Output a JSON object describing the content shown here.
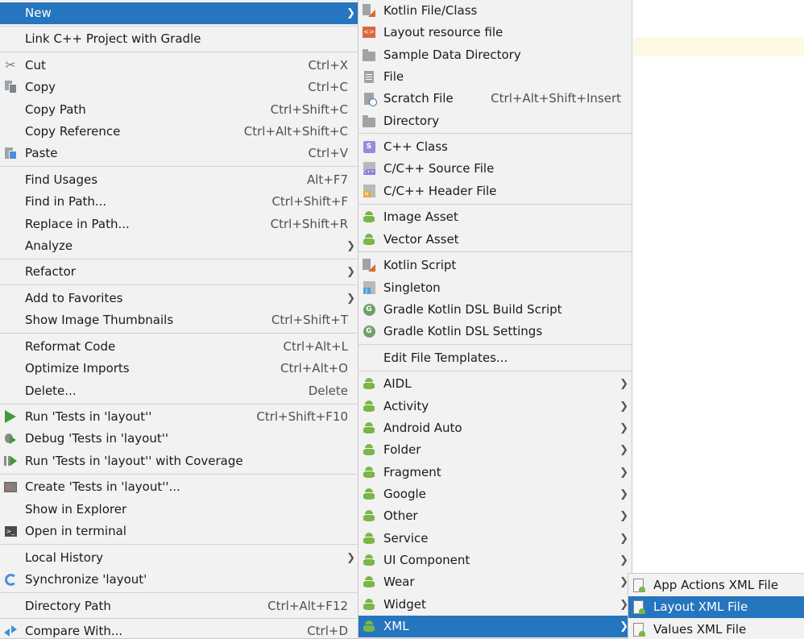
{
  "main_menu": [
    {
      "label": "New",
      "shortcut": "",
      "submenu": true,
      "selected": true,
      "icon": ""
    },
    {
      "label": "Link C++ Project with Gradle",
      "shortcut": "",
      "icon": ""
    },
    {
      "label": "Cut",
      "shortcut": "Ctrl+X",
      "icon": "scissors-icon"
    },
    {
      "label": "Copy",
      "shortcut": "Ctrl+C",
      "icon": "copy-icon"
    },
    {
      "label": "Copy Path",
      "shortcut": "Ctrl+Shift+C",
      "icon": ""
    },
    {
      "label": "Copy Reference",
      "shortcut": "Ctrl+Alt+Shift+C",
      "icon": ""
    },
    {
      "label": "Paste",
      "shortcut": "Ctrl+V",
      "icon": "paste-icon"
    },
    {
      "label": "Find Usages",
      "shortcut": "Alt+F7",
      "icon": ""
    },
    {
      "label": "Find in Path...",
      "shortcut": "Ctrl+Shift+F",
      "icon": ""
    },
    {
      "label": "Replace in Path...",
      "shortcut": "Ctrl+Shift+R",
      "icon": ""
    },
    {
      "label": "Analyze",
      "shortcut": "",
      "submenu": true,
      "icon": ""
    },
    {
      "label": "Refactor",
      "shortcut": "",
      "submenu": true,
      "icon": ""
    },
    {
      "label": "Add to Favorites",
      "shortcut": "",
      "submenu": true,
      "icon": ""
    },
    {
      "label": "Show Image Thumbnails",
      "shortcut": "Ctrl+Shift+T",
      "icon": ""
    },
    {
      "label": "Reformat Code",
      "shortcut": "Ctrl+Alt+L",
      "icon": ""
    },
    {
      "label": "Optimize Imports",
      "shortcut": "Ctrl+Alt+O",
      "icon": ""
    },
    {
      "label": "Delete...",
      "shortcut": "Delete",
      "icon": ""
    },
    {
      "label": "Run 'Tests in 'layout''",
      "shortcut": "Ctrl+Shift+F10",
      "icon": "run-icon"
    },
    {
      "label": "Debug 'Tests in 'layout''",
      "shortcut": "",
      "icon": "debug-icon"
    },
    {
      "label": "Run 'Tests in 'layout'' with Coverage",
      "shortcut": "",
      "icon": "coverage-icon"
    },
    {
      "label": "Create 'Tests in 'layout''...",
      "shortcut": "",
      "icon": "create-config-icon"
    },
    {
      "label": "Show in Explorer",
      "shortcut": "",
      "icon": ""
    },
    {
      "label": "Open in terminal",
      "shortcut": "",
      "icon": "terminal-icon"
    },
    {
      "label": "Local History",
      "shortcut": "",
      "submenu": true,
      "icon": ""
    },
    {
      "label": "Synchronize 'layout'",
      "shortcut": "",
      "icon": "sync-icon"
    },
    {
      "label": "Directory Path",
      "shortcut": "Ctrl+Alt+F12",
      "icon": ""
    },
    {
      "label": "Compare With...",
      "shortcut": "Ctrl+D",
      "icon": "compare-icon"
    }
  ],
  "new_menu": [
    {
      "label": "Kotlin File/Class",
      "shortcut": "",
      "icon": "kotlin-file-icon"
    },
    {
      "label": "Layout resource file",
      "shortcut": "",
      "icon": "layout-resource-icon"
    },
    {
      "label": "Sample Data Directory",
      "shortcut": "",
      "icon": "folder-icon"
    },
    {
      "label": "File",
      "shortcut": "",
      "icon": "file-icon"
    },
    {
      "label": "Scratch File",
      "shortcut": "Ctrl+Alt+Shift+Insert",
      "icon": "scratch-file-icon"
    },
    {
      "label": "Directory",
      "shortcut": "",
      "icon": "folder-icon"
    },
    {
      "label": "C++ Class",
      "shortcut": "",
      "icon": "cpp-class-icon"
    },
    {
      "label": "C/C++ Source File",
      "shortcut": "",
      "icon": "cpp-source-icon"
    },
    {
      "label": "C/C++ Header File",
      "shortcut": "",
      "icon": "cpp-header-icon"
    },
    {
      "label": "Image Asset",
      "shortcut": "",
      "icon": "android-icon"
    },
    {
      "label": "Vector Asset",
      "shortcut": "",
      "icon": "android-icon"
    },
    {
      "label": "Kotlin Script",
      "shortcut": "",
      "icon": "kotlin-script-icon"
    },
    {
      "label": "Singleton",
      "shortcut": "",
      "icon": "singleton-icon"
    },
    {
      "label": "Gradle Kotlin DSL Build Script",
      "shortcut": "",
      "icon": "gradle-icon"
    },
    {
      "label": "Gradle Kotlin DSL Settings",
      "shortcut": "",
      "icon": "gradle-icon"
    },
    {
      "label": "Edit File Templates...",
      "shortcut": "",
      "icon": ""
    },
    {
      "label": "AIDL",
      "shortcut": "",
      "submenu": true,
      "icon": "android-icon"
    },
    {
      "label": "Activity",
      "shortcut": "",
      "submenu": true,
      "icon": "android-icon"
    },
    {
      "label": "Android Auto",
      "shortcut": "",
      "submenu": true,
      "icon": "android-icon"
    },
    {
      "label": "Folder",
      "shortcut": "",
      "submenu": true,
      "icon": "android-icon"
    },
    {
      "label": "Fragment",
      "shortcut": "",
      "submenu": true,
      "icon": "android-icon"
    },
    {
      "label": "Google",
      "shortcut": "",
      "submenu": true,
      "icon": "android-icon"
    },
    {
      "label": "Other",
      "shortcut": "",
      "submenu": true,
      "icon": "android-icon"
    },
    {
      "label": "Service",
      "shortcut": "",
      "submenu": true,
      "icon": "android-icon"
    },
    {
      "label": "UI Component",
      "shortcut": "",
      "submenu": true,
      "icon": "android-icon"
    },
    {
      "label": "Wear",
      "shortcut": "",
      "submenu": true,
      "icon": "android-icon"
    },
    {
      "label": "Widget",
      "shortcut": "",
      "submenu": true,
      "icon": "android-icon"
    },
    {
      "label": "XML",
      "shortcut": "",
      "submenu": true,
      "selected": true,
      "icon": "android-icon"
    }
  ],
  "xml_menu": [
    {
      "label": "App Actions XML File",
      "icon": "xml-file-icon"
    },
    {
      "label": "Layout XML File",
      "icon": "xml-file-icon",
      "selected": true
    },
    {
      "label": "Values XML File",
      "icon": "xml-file-icon"
    }
  ],
  "colors": {
    "selection": "#2675bf",
    "menu_bg": "#f2f2f2",
    "android_green": "#7ab648"
  }
}
